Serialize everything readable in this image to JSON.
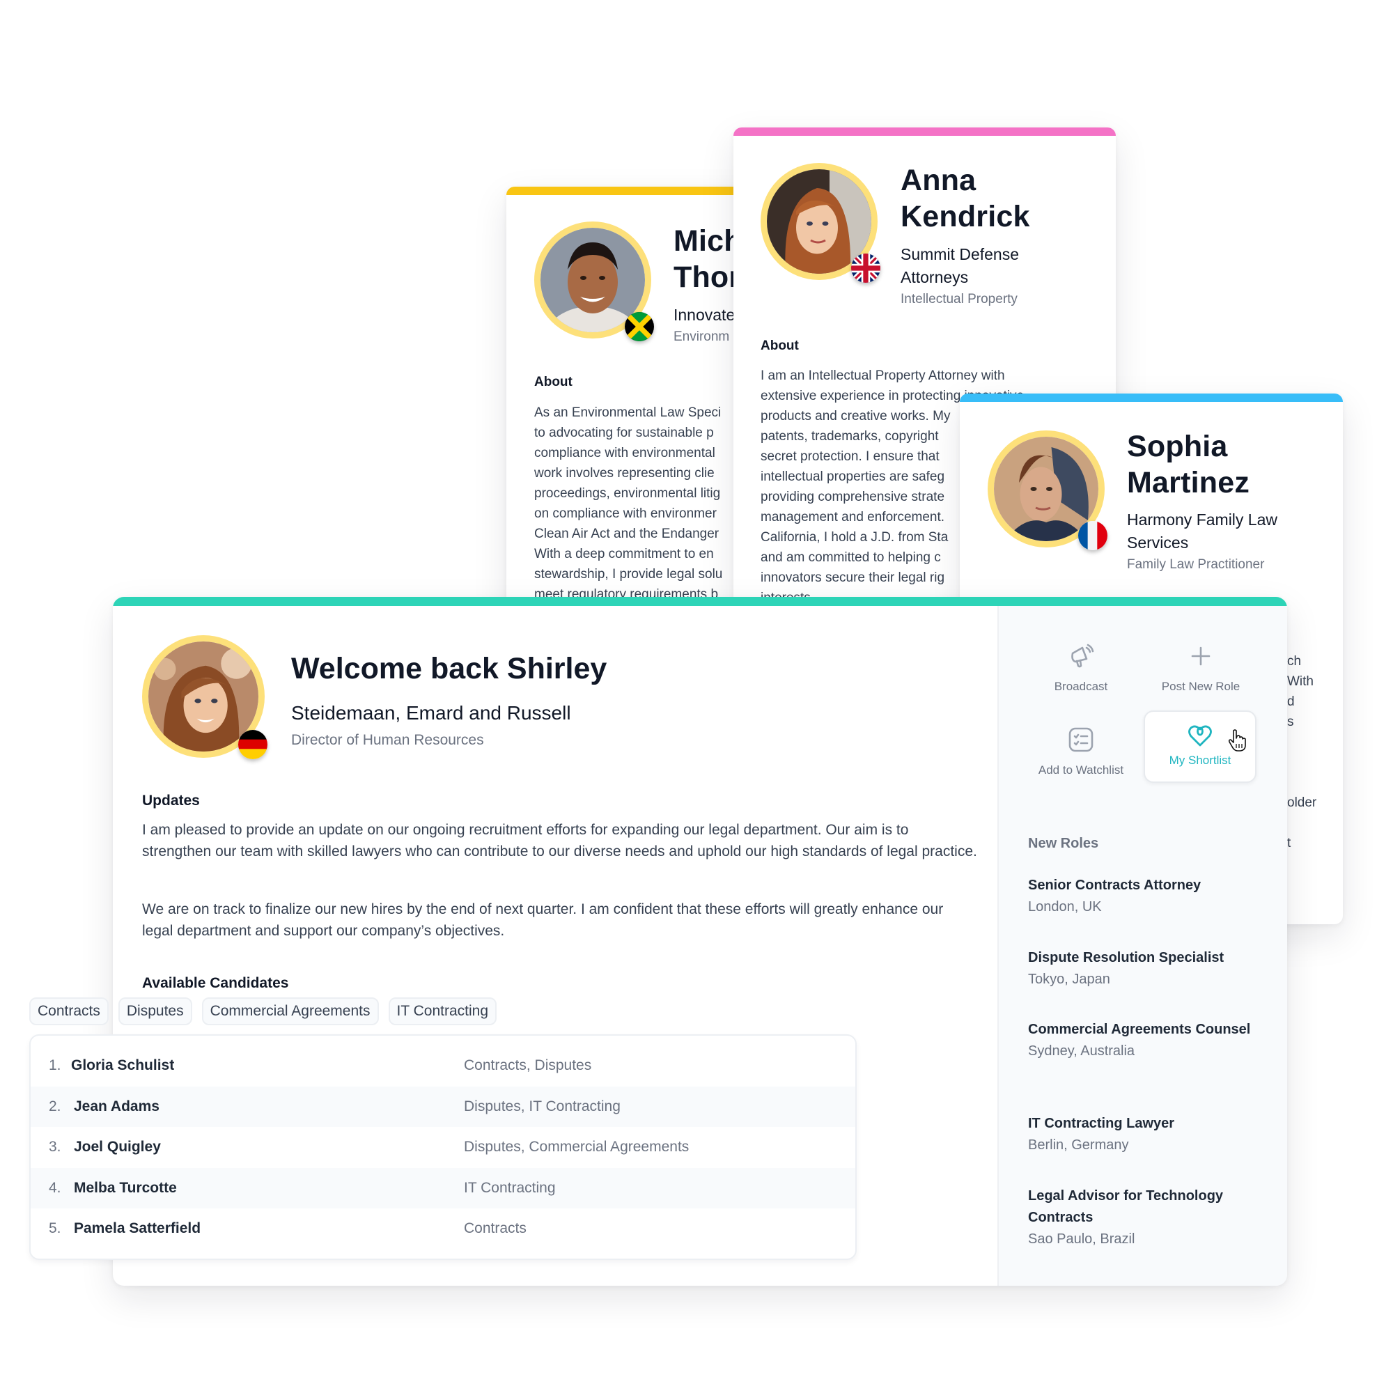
{
  "colors": {
    "main_accent": "#2dd4b7",
    "michael_accent": "#f9c513",
    "anna_accent": "#f472c6",
    "sophia_accent": "#38bdf8",
    "avatar_ring": "#fde07a",
    "shortlist_active": "#1fb5c0"
  },
  "profiles": [
    {
      "first_name": "Mich",
      "last_name": "Thor",
      "firm": "Innovate",
      "role": "Environm",
      "flag": "jamaica-flag-icon",
      "about_heading": "About",
      "about_lines": [
        "As an Environmental Law Speci",
        "to advocating for sustainable p",
        "compliance with environmental",
        "work involves representing clie",
        "proceedings, environmental litig",
        "on compliance with environmer",
        "Clean Air Act and the Endanger",
        "With a deep commitment to en",
        "stewardship, I provide legal solu",
        "meet regulatory requirements b"
      ]
    },
    {
      "first_name": "Anna",
      "last_name": "Kendrick",
      "firm_line1": "Summit Defense",
      "firm_line2": "Attorneys",
      "role": "Intellectual Property",
      "flag": "uk-flag-icon",
      "about_heading": "About",
      "about_lines": [
        "I am an Intellectual Property Attorney with",
        "extensive experience in protecting innovative",
        "products and creative works. My",
        "patents, trademarks, copyright",
        "secret protection. I ensure that",
        "intellectual properties are safeg",
        "providing comprehensive strate",
        "management and enforcement.",
        "California, I hold a J.D. from Sta",
        "and am committed to helping c",
        "innovators secure their legal rig",
        "interests."
      ]
    },
    {
      "first_name": "Sophia",
      "last_name": "Martinez",
      "firm_line1": "Harmony Family Law",
      "firm_line2": "Services",
      "role": "Family Law Practitioner",
      "flag": "france-flag-icon",
      "peek_lines": [
        "ch",
        "With",
        "d",
        "s",
        "older",
        "t"
      ]
    }
  ],
  "main": {
    "welcome": "Welcome back Shirley",
    "company": "Steidemaan, Emard and Russell",
    "title": "Director of Human Resources",
    "flag": "germany-flag-icon",
    "updates_heading": "Updates",
    "updates_p1": "I am pleased to provide an update on our ongoing recruitment efforts for expanding our legal department. Our aim is to strengthen our team with skilled lawyers who can contribute to our diverse needs and uphold our high standards of legal practice.",
    "updates_p2": "We are on track to finalize our new hires by the end of next quarter. I am confident that these efforts will greatly enhance our legal department and support our company’s objectives.",
    "candidates_heading": "Available Candidates",
    "filters": [
      "Contracts",
      "Disputes",
      "Commercial Agreements",
      "IT Contracting"
    ],
    "candidates": [
      {
        "num": "1.",
        "name": "Gloria Schulist",
        "tags": "Contracts, Disputes"
      },
      {
        "num": "2.",
        "name": "Jean Adams",
        "tags": "Disputes, IT Contracting"
      },
      {
        "num": "3.",
        "name": "Joel Quigley",
        "tags": "Disputes, Commercial Agreements"
      },
      {
        "num": "4.",
        "name": "Melba Turcotte",
        "tags": "IT Contracting"
      },
      {
        "num": "5.",
        "name": "Pamela Satterfield",
        "tags": "Contracts"
      }
    ]
  },
  "sidebar": {
    "actions": [
      {
        "label": "Broadcast",
        "icon": "megaphone-icon"
      },
      {
        "label": "Post New Role",
        "icon": "plus-icon"
      },
      {
        "label": "Add to Watchlist",
        "icon": "checklist-icon"
      },
      {
        "label": "My Shortlist",
        "icon": "heart-icon",
        "active": true
      }
    ],
    "roles_heading": "New Roles",
    "roles": [
      {
        "title": "Senior Contracts Attorney",
        "location": "London, UK"
      },
      {
        "title": "Dispute Resolution Specialist",
        "location": "Tokyo, Japan"
      },
      {
        "title": "Commercial Agreements Counsel",
        "location": "Sydney, Australia"
      },
      {
        "title": "IT Contracting Lawyer",
        "location": "Berlin, Germany"
      },
      {
        "title": "Legal Advisor for Technology Contracts",
        "location": "Sao Paulo, Brazil"
      }
    ]
  }
}
